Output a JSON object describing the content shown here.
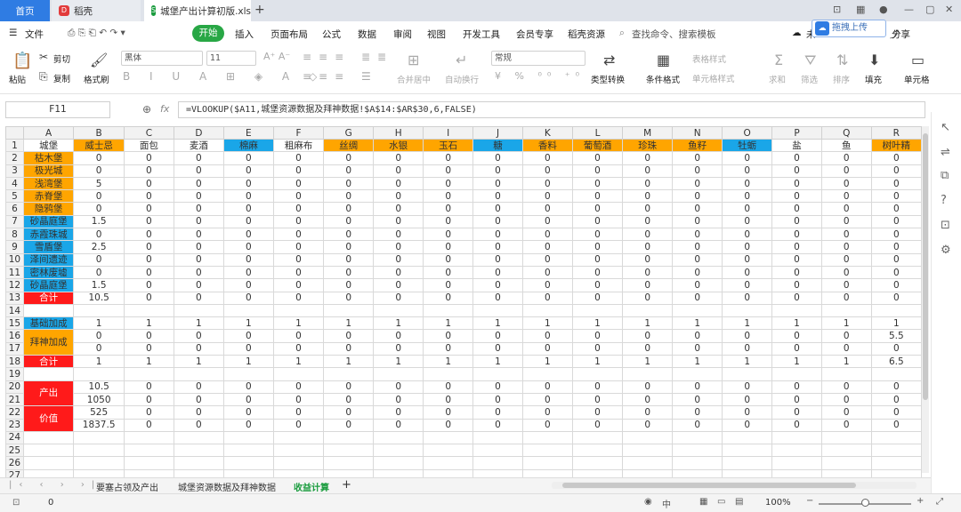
{
  "tabs": {
    "home": "首页",
    "daoke": "稻壳",
    "file": "城堡产出计算初版.xlsx"
  },
  "menu": {
    "file": "文件",
    "start": "开始",
    "items": [
      "插入",
      "页面布局",
      "公式",
      "数据",
      "审阅",
      "视图",
      "开发工具",
      "会员专享",
      "稻壳资源"
    ],
    "search": "查找命令、搜索模板",
    "share": "分享",
    "weiqi": "未",
    "upload": "拖拽上传"
  },
  "ribbon": {
    "paste": "粘贴",
    "cut": "剪切",
    "copy": "复制",
    "format_painter": "格式刷",
    "font": "黑体",
    "size": "11",
    "merge": "合并居中",
    "wrap": "自动换行",
    "numfmt": "常规",
    "convert": "类型转换",
    "cond": "条件格式",
    "table_style": "表格样式",
    "cell_style": "单元格样式",
    "sum": "求和",
    "filter": "筛选",
    "sort": "排序",
    "fill": "填充",
    "row_col": "单元格"
  },
  "formula": {
    "namebox": "F11",
    "fx": "fx",
    "text": "=VLOOKUP($A11,城堡资源数据及拜神数据!$A$14:$AR$30,6,FALSE)"
  },
  "colors": {
    "orange": "#ffa500",
    "blue": "#1aa6e8",
    "red": "#ff1a1a",
    "green": "#28a745"
  },
  "grid": {
    "col_letters": [
      "A",
      "B",
      "C",
      "D",
      "E",
      "F",
      "G",
      "H",
      "I",
      "J",
      "K",
      "L",
      "M",
      "N",
      "O",
      "P",
      "Q",
      "R"
    ],
    "header_row": [
      "城堡",
      "威士忌",
      "面包",
      "麦酒",
      "棉麻",
      "粗麻布",
      "丝绸",
      "水银",
      "玉石",
      "糖",
      "香料",
      "葡萄酒",
      "珍珠",
      "鱼籽",
      "牡蛎",
      "盐",
      "鱼",
      "树叶精"
    ],
    "header_colors": [
      "",
      "o",
      "",
      "",
      "b",
      "",
      "o",
      "o",
      "o",
      "b",
      "o",
      "o",
      "o",
      "o",
      "b",
      "",
      "",
      "o"
    ],
    "castles": [
      {
        "row": "2",
        "name": "枯木堡",
        "color": "o",
        "b": "0",
        "r": "0"
      },
      {
        "row": "3",
        "name": "极光城",
        "color": "o",
        "b": "0",
        "r": "0"
      },
      {
        "row": "4",
        "name": "浅湾堡",
        "color": "o",
        "b": "5",
        "r": "0"
      },
      {
        "row": "5",
        "name": "赤脊堡",
        "color": "o",
        "b": "0",
        "r": "0"
      },
      {
        "row": "6",
        "name": "隐鸦堡",
        "color": "o",
        "b": "0",
        "r": "0"
      },
      {
        "row": "7",
        "name": "砂晶庭堡",
        "color": "b",
        "b": "1.5",
        "r": "0"
      },
      {
        "row": "8",
        "name": "赤霞珠城",
        "color": "b",
        "b": "0",
        "r": "0"
      },
      {
        "row": "9",
        "name": "雪盾堡",
        "color": "b",
        "b": "2.5",
        "r": "0"
      },
      {
        "row": "10",
        "name": "泽间遗迹",
        "color": "b",
        "b": "0",
        "r": "0"
      },
      {
        "row": "11",
        "name": "密林废墟",
        "color": "b",
        "b": "0",
        "r": "0"
      },
      {
        "row": "12",
        "name": "砂晶庭堡",
        "color": "b",
        "b": "1.5",
        "r": "0"
      },
      {
        "row": "13",
        "name": "合计",
        "color": "r",
        "b": "10.5",
        "r": "0"
      }
    ],
    "base_label": "基础加成",
    "base_row": "15",
    "base_val": "1",
    "bless_label": "拜神加成",
    "bless_rows": [
      {
        "row": "16",
        "r": "5.5"
      },
      {
        "row": "17",
        "r": "0"
      }
    ],
    "total_label": "合计",
    "total_row": "18",
    "total_r": "6.5",
    "output_label": "产出",
    "value_label": "价值",
    "output_rows": [
      {
        "row": "20",
        "b": "10.5"
      },
      {
        "row": "21",
        "b": "1050"
      },
      {
        "row": "22",
        "b": "525"
      },
      {
        "row": "23",
        "b": "1837.5"
      }
    ],
    "empty_rows": [
      "14",
      "19",
      "24",
      "25",
      "26",
      "27"
    ]
  },
  "sheets": [
    "要塞占领及产出",
    "城堡资源数据及拜神数据",
    "收益计算"
  ],
  "status": {
    "value": "0",
    "zoom": "100%"
  }
}
